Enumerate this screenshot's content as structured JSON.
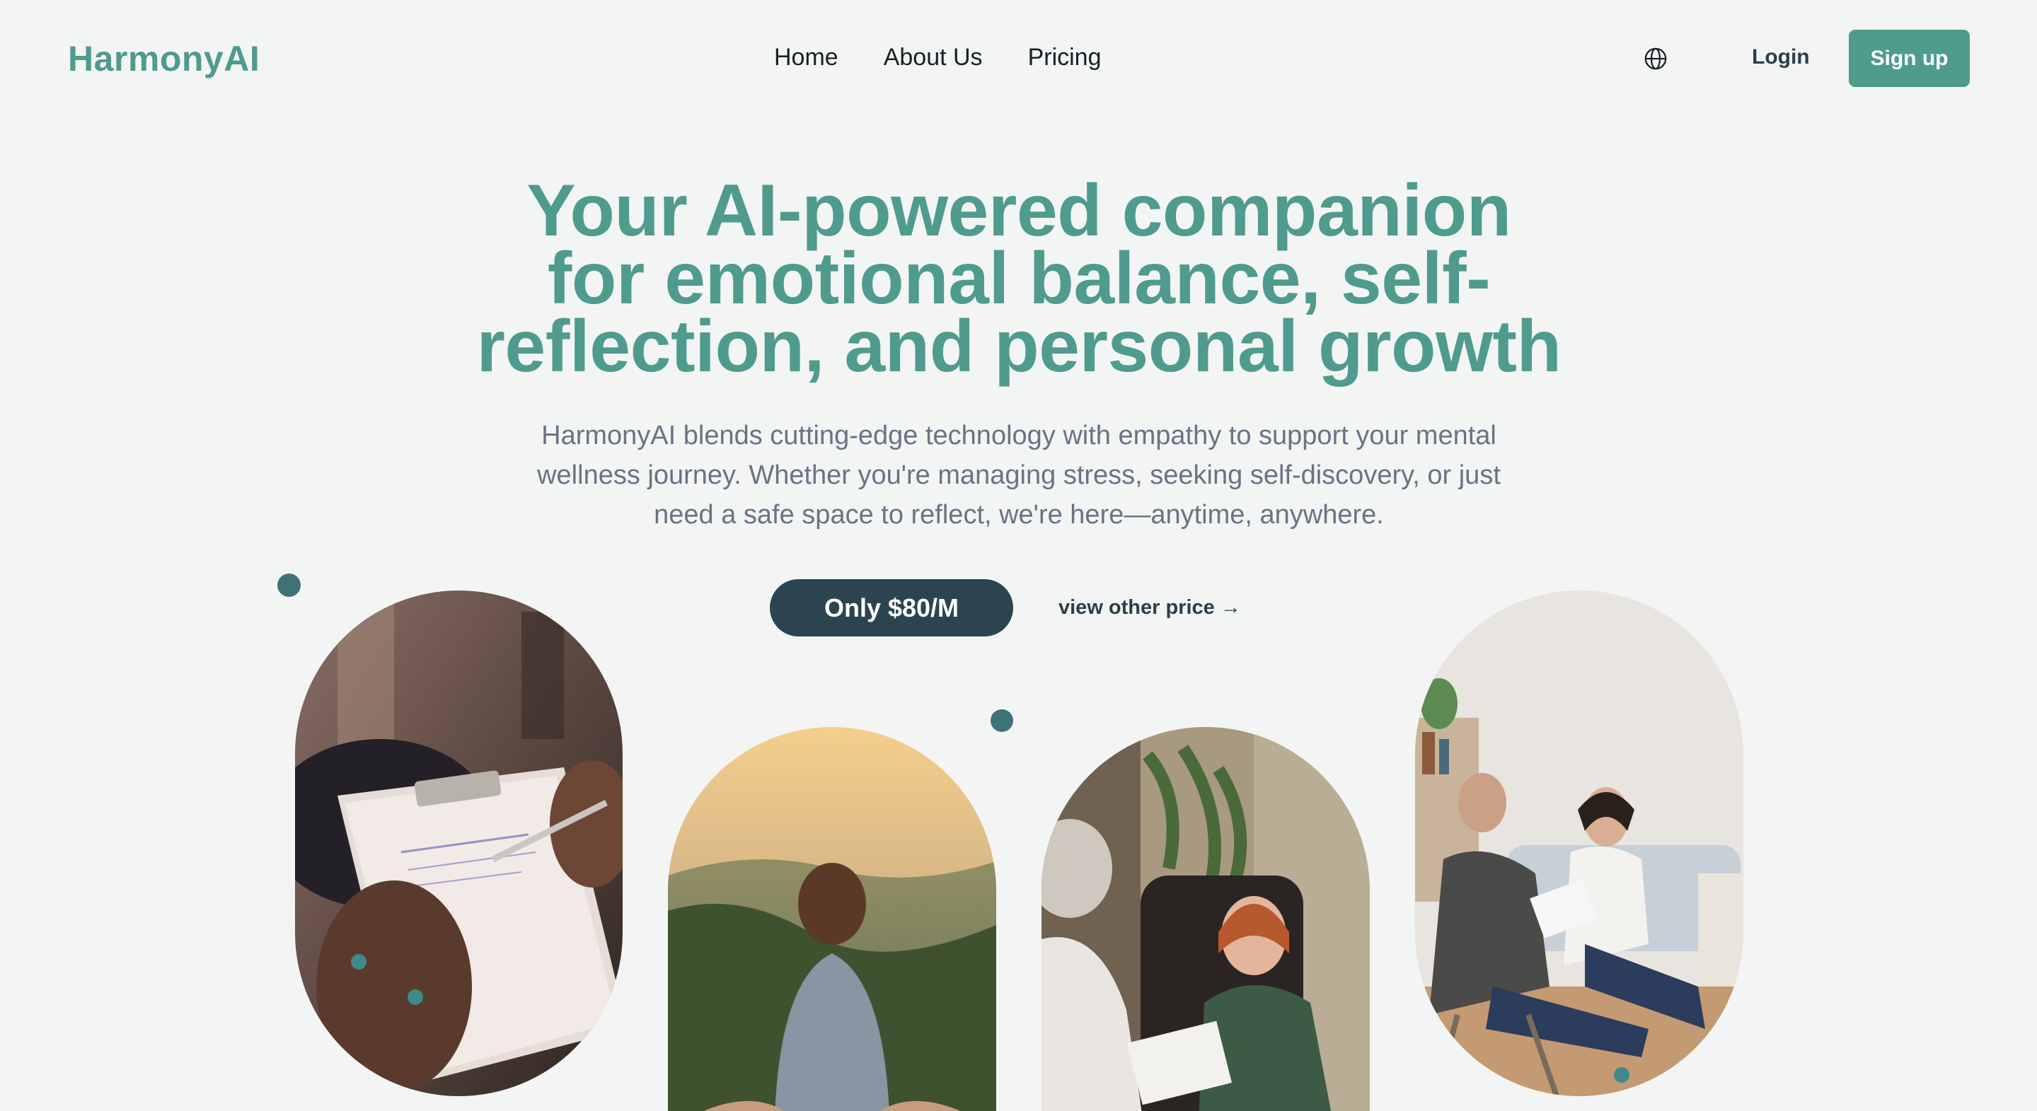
{
  "brand": {
    "name": "HarmonyAI"
  },
  "nav": {
    "links": [
      {
        "label": "Home"
      },
      {
        "label": "About Us"
      },
      {
        "label": "Pricing"
      }
    ],
    "language_icon": "globe-icon",
    "login_label": "Login",
    "signup_label": "Sign up"
  },
  "hero": {
    "headline_line1": "Your AI-powered companion",
    "headline_line2": "for emotional balance, self-",
    "headline_line3": "reflection, and personal growth",
    "subtitle_line1": "HarmonyAI blends cutting-edge technology with empathy to support your mental",
    "subtitle_line2": "wellness journey. Whether you're managing stress, seeking self-discovery, or just",
    "subtitle_line3": "need a safe space to reflect, we're here—anytime, anywhere.",
    "cta_label": "Only $80/M",
    "other_price_label": "view other price →"
  },
  "gallery": {
    "images": [
      {
        "alt": "therapist taking notes on clipboard"
      },
      {
        "alt": "woman meditating at sunset"
      },
      {
        "alt": "young woman in therapy session"
      },
      {
        "alt": "couple counseling session"
      }
    ]
  },
  "colors": {
    "accent": "#4f9b8e",
    "dark": "#2b4450",
    "background": "#f3f5f4",
    "text_muted": "#6a7385"
  }
}
